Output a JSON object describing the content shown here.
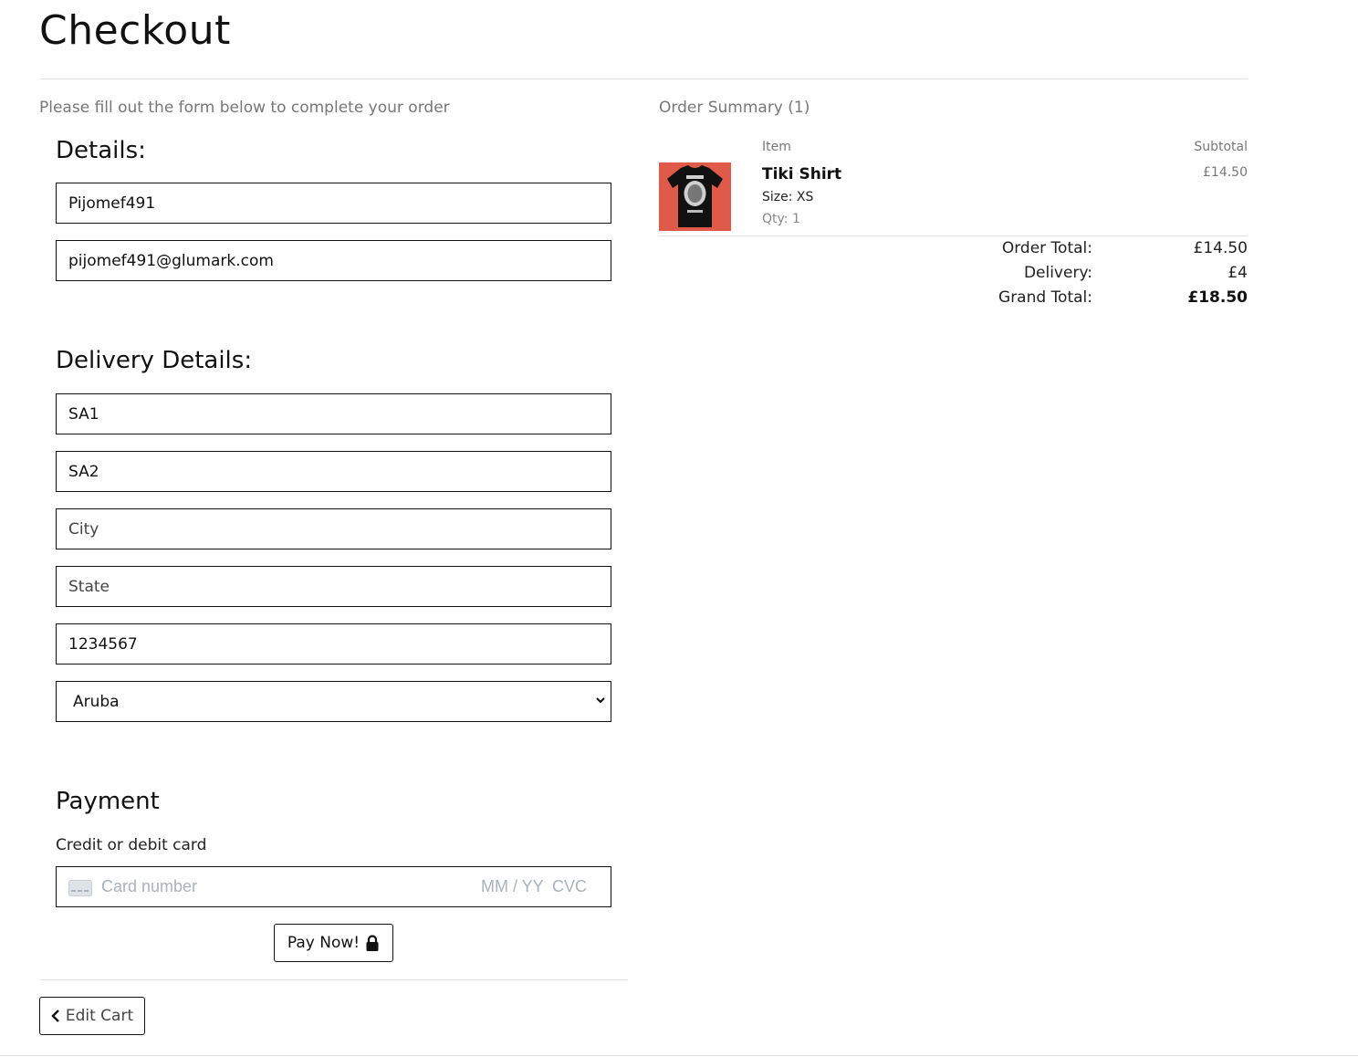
{
  "page": {
    "title": "Checkout",
    "intro": "Please fill out the form below to complete your order"
  },
  "details": {
    "heading": "Details:",
    "full_name": "Pijomef491",
    "email": "pijomef491@glumark.com"
  },
  "delivery": {
    "heading": "Delivery Details:",
    "street_address1": "SA1",
    "street_address2": "SA2",
    "city_placeholder": "City",
    "state_placeholder": "State",
    "postcode": "1234567",
    "country": "Aruba"
  },
  "payment": {
    "heading": "Payment",
    "label": "Credit or debit card",
    "card_number_placeholder": "Card number",
    "expiry_placeholder": "MM / YY",
    "cvc_placeholder": "CVC",
    "pay_button": "Pay Now!"
  },
  "nav": {
    "edit_cart": "Edit Cart"
  },
  "summary": {
    "title": "Order Summary (1)",
    "col_item": "Item",
    "col_subtotal": "Subtotal",
    "items": [
      {
        "name": "Tiki Shirt",
        "size": "Size: XS",
        "qty": "Qty: 1",
        "subtotal": "£14.50",
        "image_color": "#e05a4a"
      }
    ],
    "order_total_label": "Order Total:",
    "order_total": "£14.50",
    "delivery_label": "Delivery:",
    "delivery": "£4",
    "grand_total_label": "Grand Total:",
    "grand_total": "£18.50"
  },
  "icons": {
    "card": "credit-card-icon",
    "lock": "lock-icon",
    "chevron_left": "chevron-left-icon",
    "chevron_down": "chevron-down-icon"
  }
}
